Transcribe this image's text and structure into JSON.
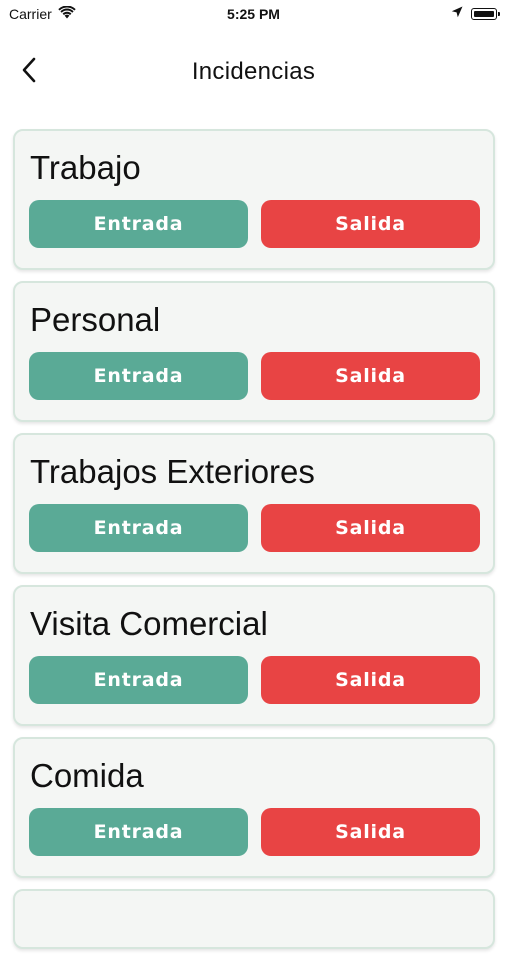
{
  "status": {
    "carrier": "Carrier",
    "time": "5:25 PM"
  },
  "nav": {
    "title": "Incidencias"
  },
  "cards": [
    {
      "title": "Trabajo",
      "entrada": "Entrada",
      "salida": "Salida"
    },
    {
      "title": "Personal",
      "entrada": "Entrada",
      "salida": "Salida"
    },
    {
      "title": "Trabajos Exteriores",
      "entrada": "Entrada",
      "salida": "Salida"
    },
    {
      "title": "Visita Comercial",
      "entrada": "Entrada",
      "salida": "Salida"
    },
    {
      "title": "Comida",
      "entrada": "Entrada",
      "salida": "Salida"
    }
  ],
  "colors": {
    "entrada": "#5aaa96",
    "salida": "#e84444"
  },
  "icons": [
    "wifi-icon",
    "back-chevron-icon",
    "location-arrow-icon",
    "battery-icon"
  ]
}
